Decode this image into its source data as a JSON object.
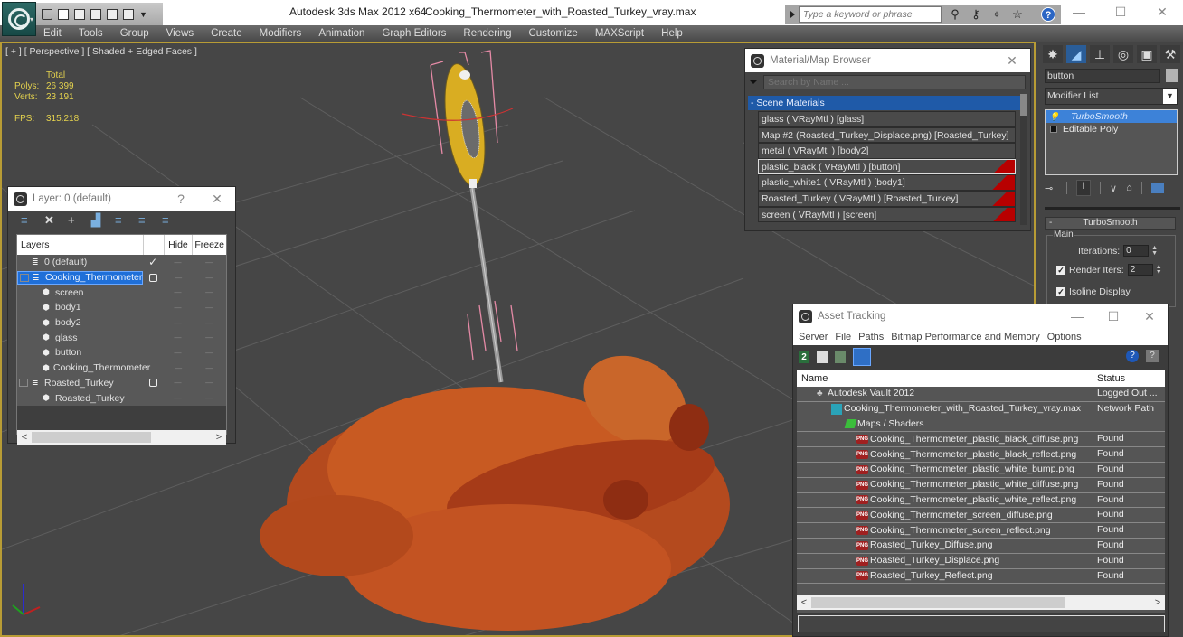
{
  "titlebar": {
    "app_title": "Autodesk 3ds Max  2012 x64",
    "file_name": "Cooking_Thermometer_with_Roasted_Turkey_vray.max",
    "search_placeholder": "Type a keyword or phrase",
    "help_label": "?",
    "minimize": "—",
    "maximize": "☐",
    "close": "✕"
  },
  "menu": [
    "Edit",
    "Tools",
    "Group",
    "Views",
    "Create",
    "Modifiers",
    "Animation",
    "Graph Editors",
    "Rendering",
    "Customize",
    "MAXScript",
    "Help"
  ],
  "viewport": {
    "label": "[ + ] [ Perspective ] [ Shaded + Edged Faces ]",
    "stats": {
      "total_label": "Total",
      "polys_label": "Polys:",
      "polys": "26 399",
      "verts_label": "Verts:",
      "verts": "23 191",
      "fps_label": "FPS:",
      "fps": "315.218"
    },
    "colors": {
      "border": "#b89c35",
      "background": "#464646",
      "stats_text": "#e4d24e"
    }
  },
  "layer_window": {
    "title": "Layer: 0 (default)",
    "help": "?",
    "close": "✕",
    "columns": [
      "Layers",
      "",
      "Hide",
      "Freeze"
    ],
    "rows": [
      {
        "name": "0 (default)",
        "type": "layer",
        "current": "✓",
        "expandable": false
      },
      {
        "name": "Cooking_Thermometer",
        "type": "layer",
        "selected": true,
        "expandable": true,
        "box": true
      },
      {
        "name": "screen",
        "type": "object"
      },
      {
        "name": "body1",
        "type": "object"
      },
      {
        "name": "body2",
        "type": "object"
      },
      {
        "name": "glass",
        "type": "object"
      },
      {
        "name": "button",
        "type": "object"
      },
      {
        "name": "Cooking_Thermometer",
        "type": "object"
      },
      {
        "name": "Roasted_Turkey",
        "type": "layer",
        "expandable": true,
        "box": true
      },
      {
        "name": "Roasted_Turkey",
        "type": "object"
      }
    ],
    "scroll_left": "<",
    "scroll_right": ">"
  },
  "material_browser": {
    "title": "Material/Map Browser",
    "close": "✕",
    "search_placeholder": "Search by Name ...",
    "group": "- Scene Materials",
    "items": [
      {
        "label": "glass  ( VRayMtl ) [glass]",
        "swatch": false
      },
      {
        "label": "Map #2 (Roasted_Turkey_Displace.png) [Roasted_Turkey]",
        "swatch": false
      },
      {
        "label": "metal  ( VRayMtl ) [body2]",
        "swatch": false
      },
      {
        "label": "plastic_black  ( VRayMtl ) [button]",
        "swatch": true,
        "selected": true
      },
      {
        "label": "plastic_white1  ( VRayMtl ) [body1]",
        "swatch": true
      },
      {
        "label": "Roasted_Turkey  ( VRayMtl ) [Roasted_Turkey]",
        "swatch": true
      },
      {
        "label": "screen  ( VRayMtl ) [screen]",
        "swatch": true
      }
    ],
    "swatch_color": "#b80000"
  },
  "command_panel": {
    "object_name": "button",
    "modifier_list": "Modifier List",
    "stack": [
      {
        "label": "TurboSmooth",
        "selected": true
      },
      {
        "label": "Editable Poly",
        "selected": false
      }
    ],
    "rollout": {
      "title": "TurboSmooth",
      "group": "Main",
      "iterations_label": "Iterations:",
      "iterations": "0",
      "render_iters_label": "Render Iters:",
      "render_iters": "2",
      "render_iters_checked": true,
      "isoline_label": "Isoline Display",
      "isoline_checked": true
    }
  },
  "asset_tracking": {
    "title": "Asset Tracking",
    "minimize": "—",
    "maximize": "☐",
    "close": "✕",
    "menu": [
      "Server",
      "File",
      "Paths",
      "Bitmap Performance and Memory",
      "Options"
    ],
    "columns": {
      "name": "Name",
      "status": "Status"
    },
    "rows": [
      {
        "name": "Autodesk Vault 2012",
        "status": "Logged Out ...",
        "icon": "vault",
        "indent": 1
      },
      {
        "name": "Cooking_Thermometer_with_Roasted_Turkey_vray.max",
        "status": "Network Path",
        "icon": "max",
        "indent": 2
      },
      {
        "name": "Maps / Shaders",
        "status": "",
        "icon": "maps",
        "indent": 3
      },
      {
        "name": "Cooking_Thermometer_plastic_black_diffuse.png",
        "status": "Found",
        "icon": "png",
        "indent": 4
      },
      {
        "name": "Cooking_Thermometer_plastic_black_reflect.png",
        "status": "Found",
        "icon": "png",
        "indent": 4
      },
      {
        "name": "Cooking_Thermometer_plastic_white_bump.png",
        "status": "Found",
        "icon": "png",
        "indent": 4
      },
      {
        "name": "Cooking_Thermometer_plastic_white_diffuse.png",
        "status": "Found",
        "icon": "png",
        "indent": 4
      },
      {
        "name": "Cooking_Thermometer_plastic_white_reflect.png",
        "status": "Found",
        "icon": "png",
        "indent": 4
      },
      {
        "name": "Cooking_Thermometer_screen_diffuse.png",
        "status": "Found",
        "icon": "png",
        "indent": 4
      },
      {
        "name": "Cooking_Thermometer_screen_reflect.png",
        "status": "Found",
        "icon": "png",
        "indent": 4
      },
      {
        "name": "Roasted_Turkey_Diffuse.png",
        "status": "Found",
        "icon": "png",
        "indent": 4
      },
      {
        "name": "Roasted_Turkey_Displace.png",
        "status": "Found",
        "icon": "png",
        "indent": 4
      },
      {
        "name": "Roasted_Turkey_Reflect.png",
        "status": "Found",
        "icon": "png",
        "indent": 4
      }
    ],
    "png_label": "PNG",
    "scroll_left": "<",
    "scroll_right": ">"
  }
}
